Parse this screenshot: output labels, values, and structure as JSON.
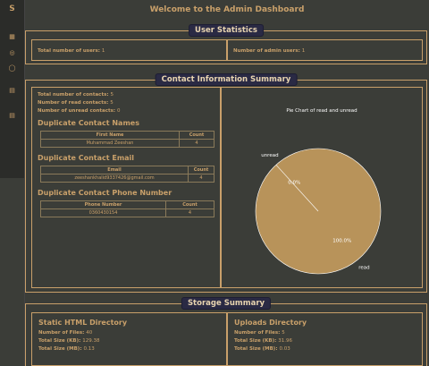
{
  "page_title": "Welcome to the Admin Dashboard",
  "user_stats": {
    "title": "User Statistics",
    "total_users_label": "Total number of users:",
    "total_users": "1",
    "total_admins_label": "Number of admin users:",
    "total_admins": "1"
  },
  "contacts": {
    "title": "Contact Information Summary",
    "total_label": "Total number of contacts:",
    "total": "5",
    "read_label": "Number of read contacts:",
    "read": "5",
    "unread_label": "Number of unread contacts:",
    "unread": "0",
    "dup_names": {
      "heading": "Duplicate Contact Names",
      "col1": "First Name",
      "col2": "Count",
      "rows": [
        {
          "name": "Muhammad Zeeshan",
          "count": "4"
        }
      ]
    },
    "dup_emails": {
      "heading": "Duplicate Contact Email",
      "col1": "Email",
      "col2": "Count",
      "rows": [
        {
          "email": "zeeshankhalid9337426@gmail.com",
          "count": "4"
        }
      ]
    },
    "dup_phones": {
      "heading": "Duplicate Contact Phone Number",
      "col1": "Phone Number",
      "col2": "Count",
      "rows": [
        {
          "phone": "0360430154",
          "count": "4"
        }
      ]
    }
  },
  "chart_data": {
    "type": "pie",
    "title": "Pie Chart of read and unread",
    "labels": [
      "read",
      "unread"
    ],
    "values": [
      100.0,
      0.0
    ],
    "pct_labels": [
      "100.0%",
      "0.0%"
    ],
    "color": "#b8935a"
  },
  "storage": {
    "title": "Storage Summary",
    "static": {
      "heading": "Static HTML Directory",
      "files_label": "Number of Files:",
      "files": "40",
      "kb_label": "Total Size (KB):",
      "kb": "129.38",
      "mb_label": "Total Size (MB):",
      "mb": "0.13"
    },
    "uploads": {
      "heading": "Uploads Directory",
      "files_label": "Number of Files:",
      "files": "5",
      "kb_label": "Total Size (KB):",
      "kb": "31.96",
      "mb_label": "Total Size (MB):",
      "mb": "0.03"
    }
  },
  "sidebar": {
    "icons": [
      "logo-icon",
      "grid-icon",
      "settings-icon",
      "chat-icon",
      "document-icon",
      "document-icon"
    ]
  }
}
